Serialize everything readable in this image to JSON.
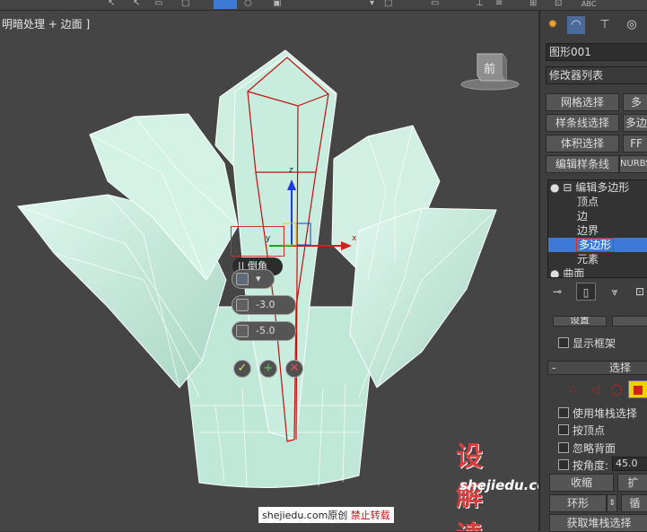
{
  "viewport": {
    "label": "明暗处理 + 边面 ]",
    "viewcube_label": "前",
    "caddy": {
      "title": "倒角",
      "grip": "||",
      "mode_dropdown_arrow": "▾",
      "height_value": "-3.0",
      "outline_value": "-5.0",
      "ok_icon": "✓",
      "apply_icon": "+",
      "cancel_icon": "✕"
    },
    "gizmo": {
      "z_label": "z",
      "x_label": "x",
      "y_label": "y"
    }
  },
  "panel": {
    "object_name": "图形001",
    "modifier_list": "修改器列表",
    "buttons": {
      "poly_select": "网格选择",
      "poly_select_2": "多",
      "spline_select": "样条线选择",
      "poly_sel_right": "多边",
      "vol_select": "体积选择",
      "ffd": "FF",
      "edit_spline": "编辑样条线",
      "nurbs": "NURBS"
    },
    "stack": {
      "root": "编辑多边形",
      "items": [
        "顶点",
        "边",
        "边界",
        "多边形",
        "元素"
      ],
      "selected_index": 3,
      "next": "曲面"
    },
    "settings_btn": "设置",
    "show_cage": "显示框架",
    "selection_rollout": {
      "minus": "-",
      "title": "选择",
      "use_stack": "使用堆栈选择",
      "by_vertex": "按顶点",
      "ignore_backfacing": "忽略背面",
      "by_angle": "按角度:",
      "angle_value": "45.0",
      "shrink": "收缩",
      "grow": "扩",
      "ring": "环形",
      "loop": "循",
      "get_stack_selection": "获取堆栈选择"
    }
  },
  "watermark": {
    "logo": "设解读",
    "url": "shejiedu.com"
  },
  "caption": {
    "site": "shejiedu.com",
    "original": "原创",
    "no_repost": "禁止转载"
  },
  "colors": {
    "mesh": "#c6ede0",
    "selected_poly_edges": "#c01010",
    "stack_selection": "#3d7ad8",
    "watermark_red": "#d83c3c"
  }
}
